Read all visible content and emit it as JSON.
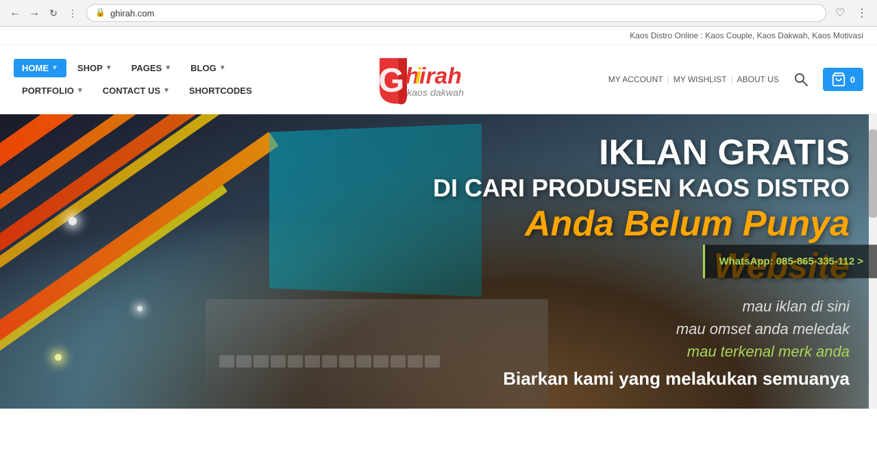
{
  "browser": {
    "url": "ghirah.com",
    "back_title": "Back",
    "forward_title": "Forward",
    "refresh_title": "Refresh",
    "grid_title": "Apps"
  },
  "topbar": {
    "text": "Kaos Distro Online : Kaos Couple, Kaos Dakwah, Kaos Motivasi"
  },
  "nav": {
    "row1": [
      {
        "label": "HOME",
        "active": true,
        "has_arrow": true
      },
      {
        "label": "SHOP",
        "active": false,
        "has_arrow": true
      },
      {
        "label": "PAGES",
        "active": false,
        "has_arrow": true
      },
      {
        "label": "BLOG",
        "active": false,
        "has_arrow": true
      }
    ],
    "row2": [
      {
        "label": "PORTFOLIO",
        "active": false,
        "has_arrow": true
      },
      {
        "label": "CONTACT US",
        "active": false,
        "has_arrow": true
      },
      {
        "label": "SHORTCODES",
        "active": false,
        "has_arrow": false
      }
    ]
  },
  "rightNav": {
    "my_account": "MY ACCOUNT",
    "my_wishlist": "MY WISHLIST",
    "about_us": "ABOUT US",
    "cart_count": "0"
  },
  "hero": {
    "line1": "IKLAN GRATIS",
    "line2": "DI CARI PRODUSEN KAOS DISTRO",
    "line3": "Anda Belum Punya Website",
    "line4": "mau iklan di sini",
    "line5": "mau omset anda meledak",
    "line6": "mau terkenal merk anda",
    "line7": "Biarkan kami yang melakukan semuanya",
    "whatsapp": "WhatsApp: 085-865-335-112 >"
  }
}
